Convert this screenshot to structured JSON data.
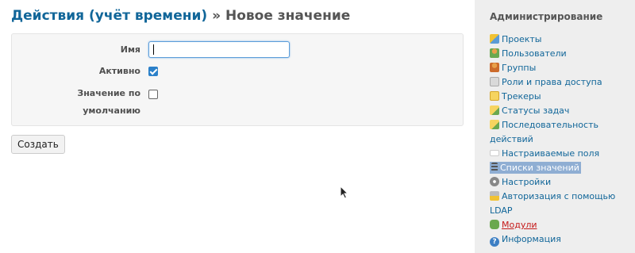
{
  "header": {
    "breadcrumb_link": "Действия (учёт времени)",
    "separator": " » ",
    "title": "Новое значение"
  },
  "form": {
    "name_label": "Имя",
    "name_value": "",
    "active_label": "Активно",
    "active_checked": true,
    "default_label_line1": "Значение по",
    "default_label_line2": "умолчанию",
    "default_checked": false,
    "submit_label": "Создать"
  },
  "sidebar": {
    "title": "Администрирование",
    "items": [
      {
        "label": "Проекты",
        "icon": "projects-icon"
      },
      {
        "label": "Пользователи",
        "icon": "users-icon"
      },
      {
        "label": "Группы",
        "icon": "groups-icon"
      },
      {
        "label": "Роли и права доступа",
        "icon": "roles-icon"
      },
      {
        "label": "Трекеры",
        "icon": "trackers-icon"
      },
      {
        "label": "Статусы задач",
        "icon": "issue-statuses-icon"
      },
      {
        "label_line1": "Последовательность",
        "label_line2": "действий",
        "icon": "workflow-icon"
      },
      {
        "label": "Настраиваемые поля",
        "icon": "custom-fields-icon"
      },
      {
        "label": "Списки значений",
        "icon": "enumerations-icon",
        "selected": true
      },
      {
        "label": "Настройки",
        "icon": "settings-icon"
      },
      {
        "label_line1": "Авторизация с помощью",
        "label_line2": "LDAP",
        "icon": "ldap-icon"
      },
      {
        "label": "Модули",
        "icon": "plugins-icon"
      },
      {
        "label": "Информация",
        "icon": "info-icon"
      }
    ]
  },
  "colors": {
    "link": "#116699",
    "selected_bg": "#8faed3",
    "sidebar_bg": "#eeeeee",
    "checkbox_checked": "#2b80c9",
    "module_link": "#c61a1a"
  }
}
